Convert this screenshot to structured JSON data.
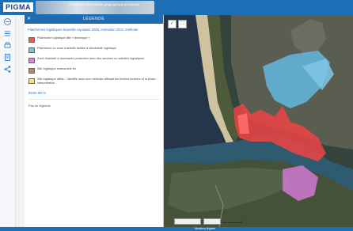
{
  "header": {
    "logo_text": "PIGMA",
    "banner_text": "Plateforme d'information géographique mutualisée"
  },
  "sidebar_tools": [
    {
      "icon": "layers-icon"
    },
    {
      "icon": "list-icon"
    },
    {
      "icon": "print-icon"
    },
    {
      "icon": "document-icon"
    },
    {
      "icon": "share-icon"
    }
  ],
  "legend_panel": {
    "title": "LÉGENDE",
    "layer_title": "Plateformes logistiques Nouvelle-Aquitaine 2020, extraction OCS, méthode",
    "items": [
      {
        "color": "#e85a5a",
        "label": "Plateforme logistique dite « technique »"
      },
      {
        "color": "#6dc7e6",
        "label": "Plateforme ou zone d'activité dédiée à dominante logistique"
      },
      {
        "color": "#d58ad8",
        "label": "Zone d'activité à dominante productive avec des services ou activités logistiques"
      },
      {
        "color": "#b98a5c",
        "label": "Site logistique embranché fer"
      },
      {
        "color": "#f6e18a",
        "label": "Site logistique diffus – identifié avec une méthode utilisant les fichiers fonciers et la photo-interprétation"
      }
    ],
    "visibility_limit": "Entre 60 m",
    "no_legend": "Pas de légende"
  },
  "map": {
    "zoom_extent_icon": "fullscreen-icon",
    "check_icon": "check-icon"
  },
  "footer": {
    "text": "Mentions légales"
  }
}
